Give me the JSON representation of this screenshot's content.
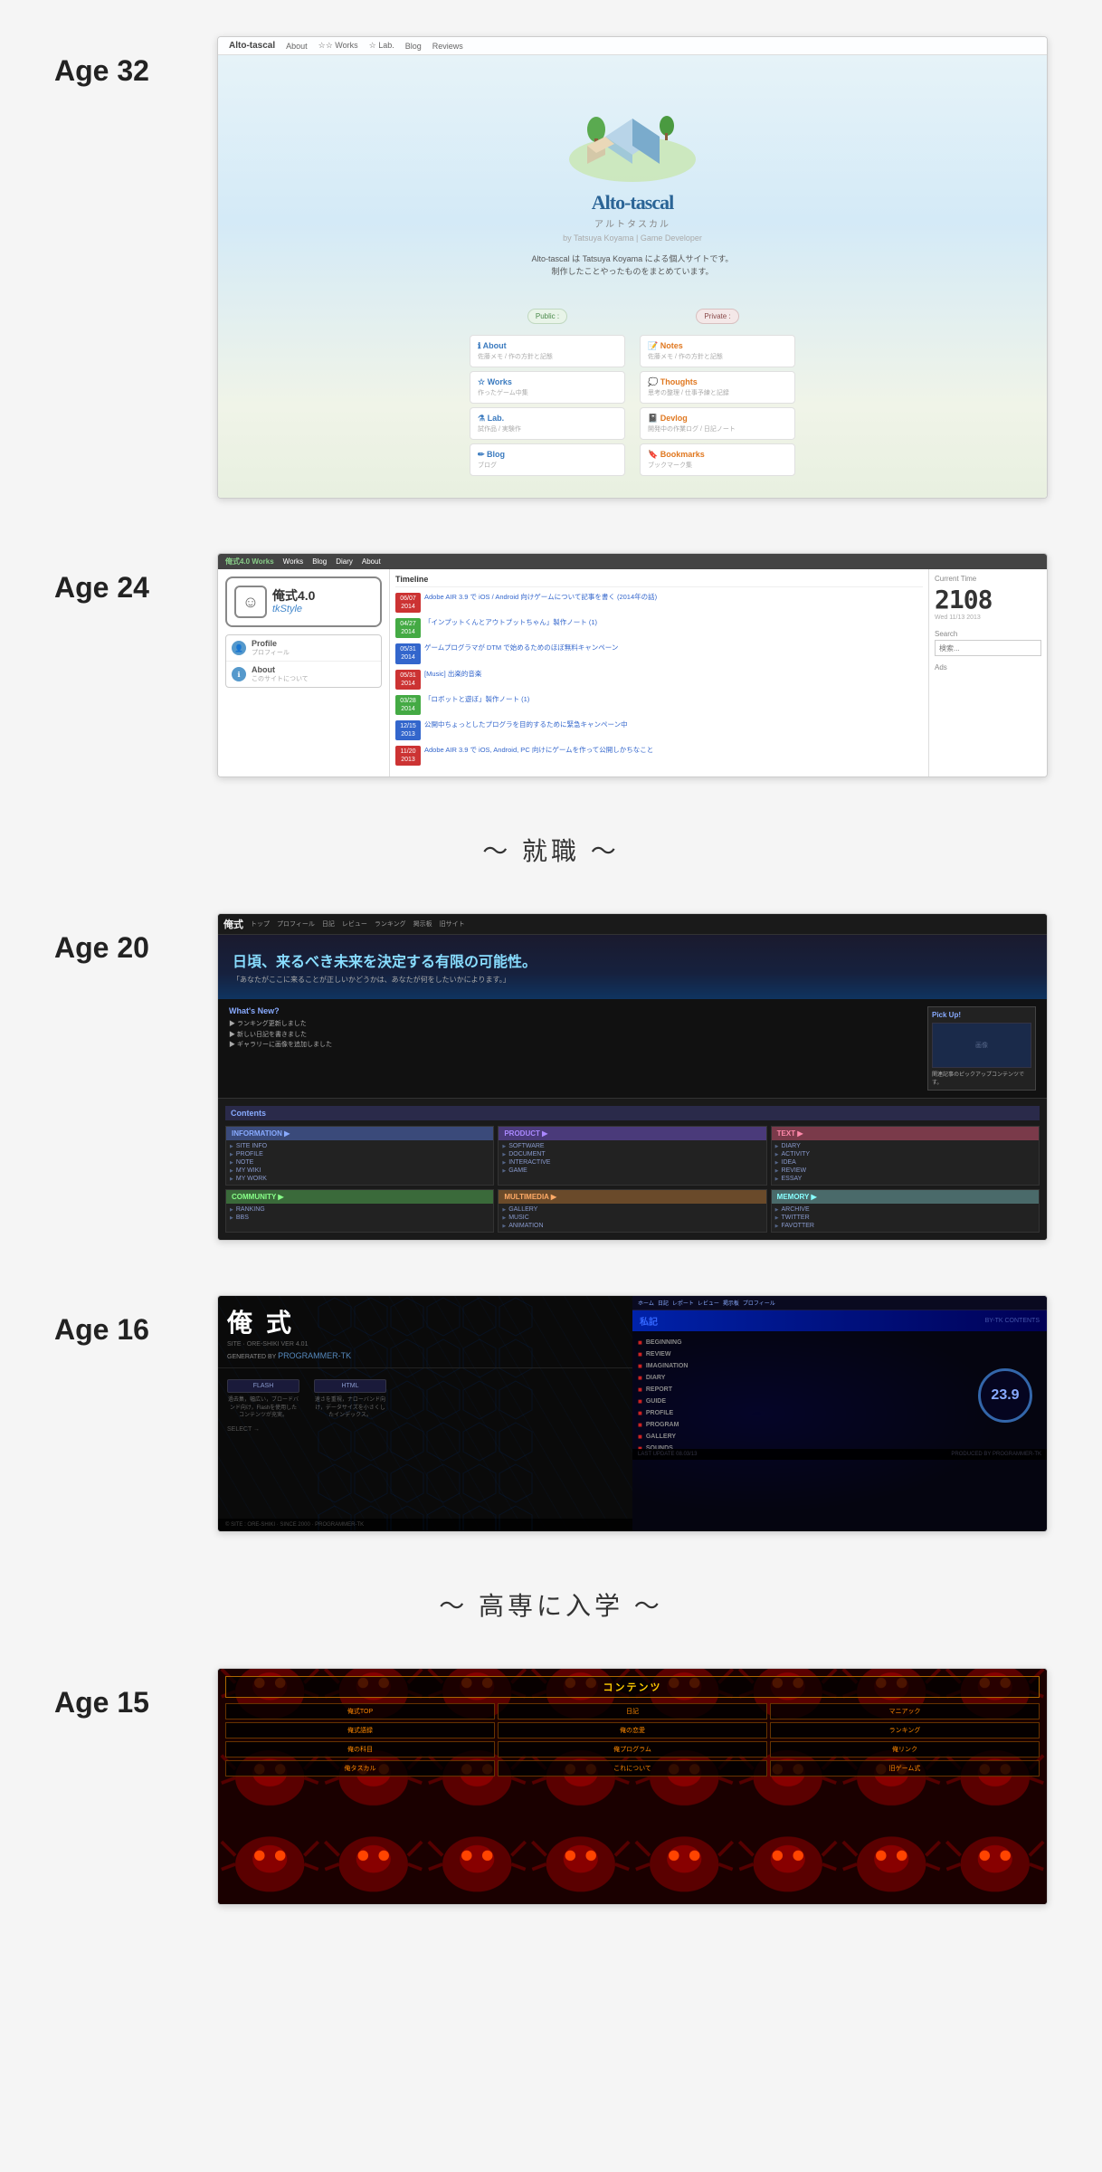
{
  "page": {
    "background": "#f5f5f5"
  },
  "sections": [
    {
      "id": "age32",
      "age_label": "Age 32",
      "site": {
        "name": "Alto-tascal",
        "name_jp": "アルトタスカル",
        "byline": "by Tatsuya Koyama | Game Developer",
        "nav_items": [
          "About",
          "☆☆ Works",
          "☆ Lab.",
          "☆☆ Blog",
          "Reviews"
        ],
        "description_line1": "Alto-tascal は Tatsuya Koyama による個人サイトです。",
        "description_line2": "制作したことやったものをまとめています。",
        "public_label": "Public :",
        "private_label": "Private :",
        "public_items": [
          {
            "icon": "ℹ",
            "title": "About",
            "desc": "佐藤メモ / 作の方針と記態",
            "color": "blue"
          },
          {
            "icon": "☆",
            "title": "Works",
            "desc": "作ったゲーム中集",
            "color": "blue"
          },
          {
            "icon": "⚗",
            "title": "Lab.",
            "desc": "試作品 / 実験作",
            "color": "blue"
          },
          {
            "icon": "✏",
            "title": "Blog",
            "desc": "ブログ",
            "color": "blue"
          }
        ],
        "private_items": [
          {
            "icon": "📝",
            "title": "Notes",
            "desc": "佐藤メモ / 作の方針と記態",
            "color": "orange"
          },
          {
            "icon": "💭",
            "title": "Thoughts",
            "desc": "思考の整理 / 仕事予練と記録",
            "color": "orange"
          },
          {
            "icon": "📓",
            "title": "Devlog",
            "desc": "開発中の作業ログ / 日記ノート",
            "color": "orange"
          },
          {
            "icon": "🔖",
            "title": "Bookmarks",
            "desc": "ブックマーク集",
            "color": "orange"
          }
        ]
      }
    },
    {
      "id": "age24",
      "age_label": "Age 24",
      "site": {
        "nav_logo": "俺式4.0 Works",
        "nav_items": [
          "Works",
          "Blog",
          "Diary",
          "About"
        ],
        "logo_main": "俺式4.0",
        "logo_sub": "tkStyle",
        "profile_label": "Profile",
        "profile_sub": "プロフィール",
        "about_label": "About",
        "about_sub": "このサイトについて",
        "timeline_header": "Timeline",
        "current_time_header": "Current Time",
        "time_display": "2108",
        "time_day": "Wed",
        "time_date": "11/13",
        "time_year": "2013",
        "search_label": "Search",
        "ads_label": "Ads",
        "timeline_items": [
          {
            "date": "06/07\n2014",
            "color": "red",
            "text": "Adobe AIR 3.9 で iOS / Android 向けゲームについて記事を書く (2014年の話)"
          },
          {
            "date": "04/27\n2014",
            "color": "green",
            "text": "「インプットくんとアウトプットちゃん」製作ノート (1)"
          },
          {
            "date": "05/31\n2014",
            "color": "blue",
            "text": "ゲームプログラマが DTM で始めるためのほぼ無料キャンペーン"
          },
          {
            "date": "05/31\n2014",
            "color": "red",
            "text": "[Music] 出楽的音楽"
          },
          {
            "date": "03/28\n2014",
            "color": "green",
            "text": "「ロボットと遊ぼ」製作ノート (1)"
          },
          {
            "date": "12/15\n2013",
            "color": "blue",
            "text": "公開中ちょっとしたプログラを目的するために緊急キャンペーン中"
          },
          {
            "date": "11/20\n2013",
            "color": "red",
            "text": "Adobe AIR 3.9 で iOS, Android, PC 向けにゲームを作って公開しかちなこと"
          }
        ]
      }
    }
  ],
  "separator1": {
    "text": "〜 就職 〜"
  },
  "section_age20": {
    "age_label": "Age 20",
    "site": {
      "nav_logo": "俺式",
      "nav_items": [
        "トップ",
        "プロフィール",
        "日記",
        "レビュー",
        "ランキング",
        "掲示板",
        "旧サイト"
      ],
      "hero_text": "日頃、来るべき未来を決定する有限の可能性。",
      "hero_sub": "「あなたがここに来ることが正しいかどうかは、あなたが何をしたいかによります。」",
      "whats_new": "What's New?",
      "pickup": "Pick Up!",
      "contents_header": "Contents",
      "sections": [
        {
          "header": "INFORMATION",
          "color": "info",
          "items": [
            "SITE INFO",
            "PROFILE",
            "NOTE",
            "MY WIKI",
            "MY WORK"
          ]
        },
        {
          "header": "PRODUCT",
          "color": "product",
          "items": [
            "SOFTWARE",
            "DOCUMENT",
            "INTERACTIVE",
            "GAME"
          ]
        },
        {
          "header": "TEXT",
          "color": "text",
          "items": [
            "DIARY",
            "ACTIVITY",
            "IDEA",
            "REVIEW",
            "ESSAY"
          ]
        },
        {
          "header": "COMMUNITY",
          "color": "community",
          "items": [
            "RANKING",
            "BBS"
          ]
        },
        {
          "header": "MULTIMEDIA",
          "color": "multimedia",
          "items": [
            "GALLERY",
            "MUSIC",
            "ANIMATION"
          ]
        },
        {
          "header": "MEMORY",
          "color": "memory",
          "items": [
            "ARCHIVE",
            "TWITTER",
            "FAVOTTER"
          ]
        }
      ]
    }
  },
  "section_age16": {
    "age_label": "Age 16",
    "left_site": {
      "logo": "俺 式",
      "subtitle": "SITE · ORE-SHIKI VER 4.01",
      "programmer": "PROGRAMMER-TK",
      "flash_label": "FLASH",
      "html_label": "HTML",
      "flash_desc": "過去集，幅広い，ブロードバンド向け，Flashを使用したコンテンツが充実。",
      "html_desc": "速さを重視，ナローバンド向け，データサイズを小さくしたインデックス。",
      "bottom_text": "© SITE : ORE-SHIKI · SINCE 2000 · PROGRAMMER-TK"
    },
    "right_site": {
      "title": "私記",
      "by_title": "BY-TK CONTENTS",
      "nav_items": [
        "BEGINNING",
        "REVIEW",
        "IMAGINATION",
        "DIARY",
        "REPORT",
        "GUIDE",
        "PROFILE",
        "PROGRAM",
        "GALLERY",
        "SOUNDS"
      ],
      "circle_value": "23.9",
      "last_update": "LAST UPDATE 08.03/13",
      "items": [
        "DIARY",
        "REPORT",
        "GUIDE",
        "PROFILE",
        "PROGRAM",
        "GALLERY",
        "SOUNDS"
      ]
    }
  },
  "separator2": {
    "text": "〜 高専に入学 〜"
  },
  "section_age15": {
    "age_label": "Age 15",
    "site": {
      "title": "コンテンツ",
      "items": [
        "俺式TOP",
        "日記",
        "マニアック",
        "俺式語録",
        "俺の恋愛",
        "ランキング",
        "俺の科目",
        "俺プログラム",
        "俺リンク",
        "俺タスカル",
        "これについて",
        "旧ゲーム式"
      ]
    }
  }
}
